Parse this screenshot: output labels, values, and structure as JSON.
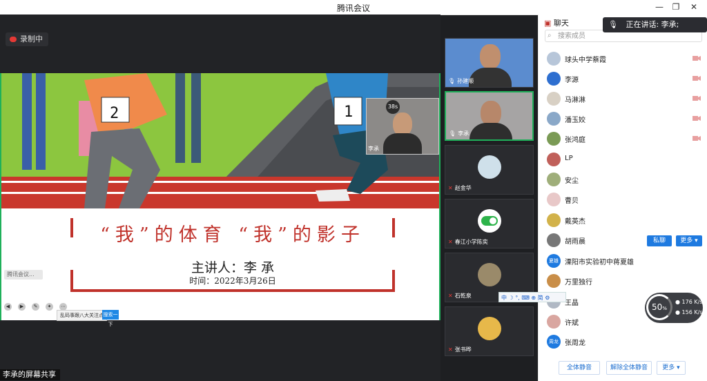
{
  "window": {
    "title": "腾讯会议"
  },
  "stage": {
    "recording": "录制中",
    "slide": {
      "title": "“我”的体育 “我”的影子",
      "presenter": "主讲人：李 承",
      "date": "时间：2022年3月26日",
      "bib_left": "2",
      "bib_right": "1",
      "pip_name": "李承",
      "pip_timer": "38s"
    },
    "screen_share_label": "李承的屏幕共享",
    "mini_share": "腾讯会议...",
    "ime_text": "乱码事跟八大关注点",
    "ime_button": "搜索一下"
  },
  "video_tiles": [
    {
      "name": "孙建顺",
      "kind": "video"
    },
    {
      "name": "李承",
      "kind": "video",
      "active": true
    },
    {
      "name": "赵金华",
      "kind": "avatar"
    },
    {
      "name": "春江小学陈奕",
      "kind": "toggle"
    },
    {
      "name": "石乾泉",
      "kind": "avatar"
    },
    {
      "name": "张书晔",
      "kind": "avatar"
    }
  ],
  "panel": {
    "header": "聊天",
    "speaking": "正在讲话: 李承;",
    "search_placeholder": "搜索成员",
    "members": [
      {
        "name": "球头中学蔡霞",
        "color": "#b7c6d9",
        "cam_off": true
      },
      {
        "name": "李源",
        "color": "#2e6fd0",
        "cam_off": true
      },
      {
        "name": "马淋淋",
        "color": "#d8d0c4",
        "cam_off": true
      },
      {
        "name": "潘玉姣",
        "color": "#8aa8c8",
        "cam_off": true
      },
      {
        "name": "张鸿庭",
        "color": "#7a9a55",
        "cam_off": true
      },
      {
        "name": "LP",
        "color": "#c0605a",
        "cam_off": false
      },
      {
        "name": "安尘",
        "color": "#9fae7a",
        "cam_off": false
      },
      {
        "name": "曹贝",
        "color": "#e8c8c8",
        "cam_off": false
      },
      {
        "name": "戴英杰",
        "color": "#d2b24a",
        "cam_off": false
      },
      {
        "name": "胡雨晨",
        "color": "#777777",
        "cam_off": false
      },
      {
        "name": "溧阳市实验初中蒋夏雄",
        "color": "#1e7ae0",
        "avatar_text": "夏雄",
        "cam_off": false
      },
      {
        "name": "万里独行",
        "color": "#c98e48",
        "cam_off": false
      },
      {
        "name": "王晶",
        "color": "#b0b8c4",
        "cam_off": false
      },
      {
        "name": "许斌",
        "color": "#d9a6a0",
        "cam_off": false
      },
      {
        "name": "张周龙",
        "color": "#1e7ae0",
        "avatar_text": "周龙",
        "cam_off": false
      }
    ],
    "private_chat": "私聊",
    "more": "更多 ▾",
    "mute_all": "全体静音",
    "unmute_all": "解除全体静音",
    "more_footer": "更多 ▾"
  },
  "ime_bar": {
    "text": "中 ☽ °, ⌨ ⊕ 简 ⚙"
  },
  "network": {
    "percent": "50",
    "percent_unit": "%",
    "up": "176",
    "down": "156",
    "unit": "K/s"
  }
}
